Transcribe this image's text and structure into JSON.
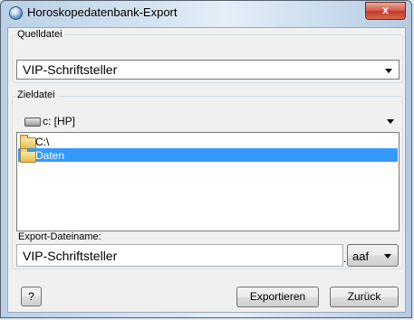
{
  "window": {
    "title": "Horoskopedatenbank-Export",
    "close_label": "x"
  },
  "quelldatei": {
    "label": "Quelldatei",
    "selected": "VIP-Schriftsteller"
  },
  "zieldatei": {
    "label": "Zieldatei",
    "drive": "c: [HP]",
    "folders": [
      {
        "label": "C:\\",
        "selected": false
      },
      {
        "label": "Daten",
        "selected": true
      }
    ]
  },
  "export": {
    "label": "Export-Dateiname:",
    "filename": "VIP-Schriftsteller",
    "extension": "aaf"
  },
  "buttons": {
    "help": "?",
    "export": "Exportieren",
    "back": "Zurück"
  },
  "icons": [
    "app-icon",
    "drive-icon",
    "folder-icon",
    "chevron-down-icon"
  ]
}
